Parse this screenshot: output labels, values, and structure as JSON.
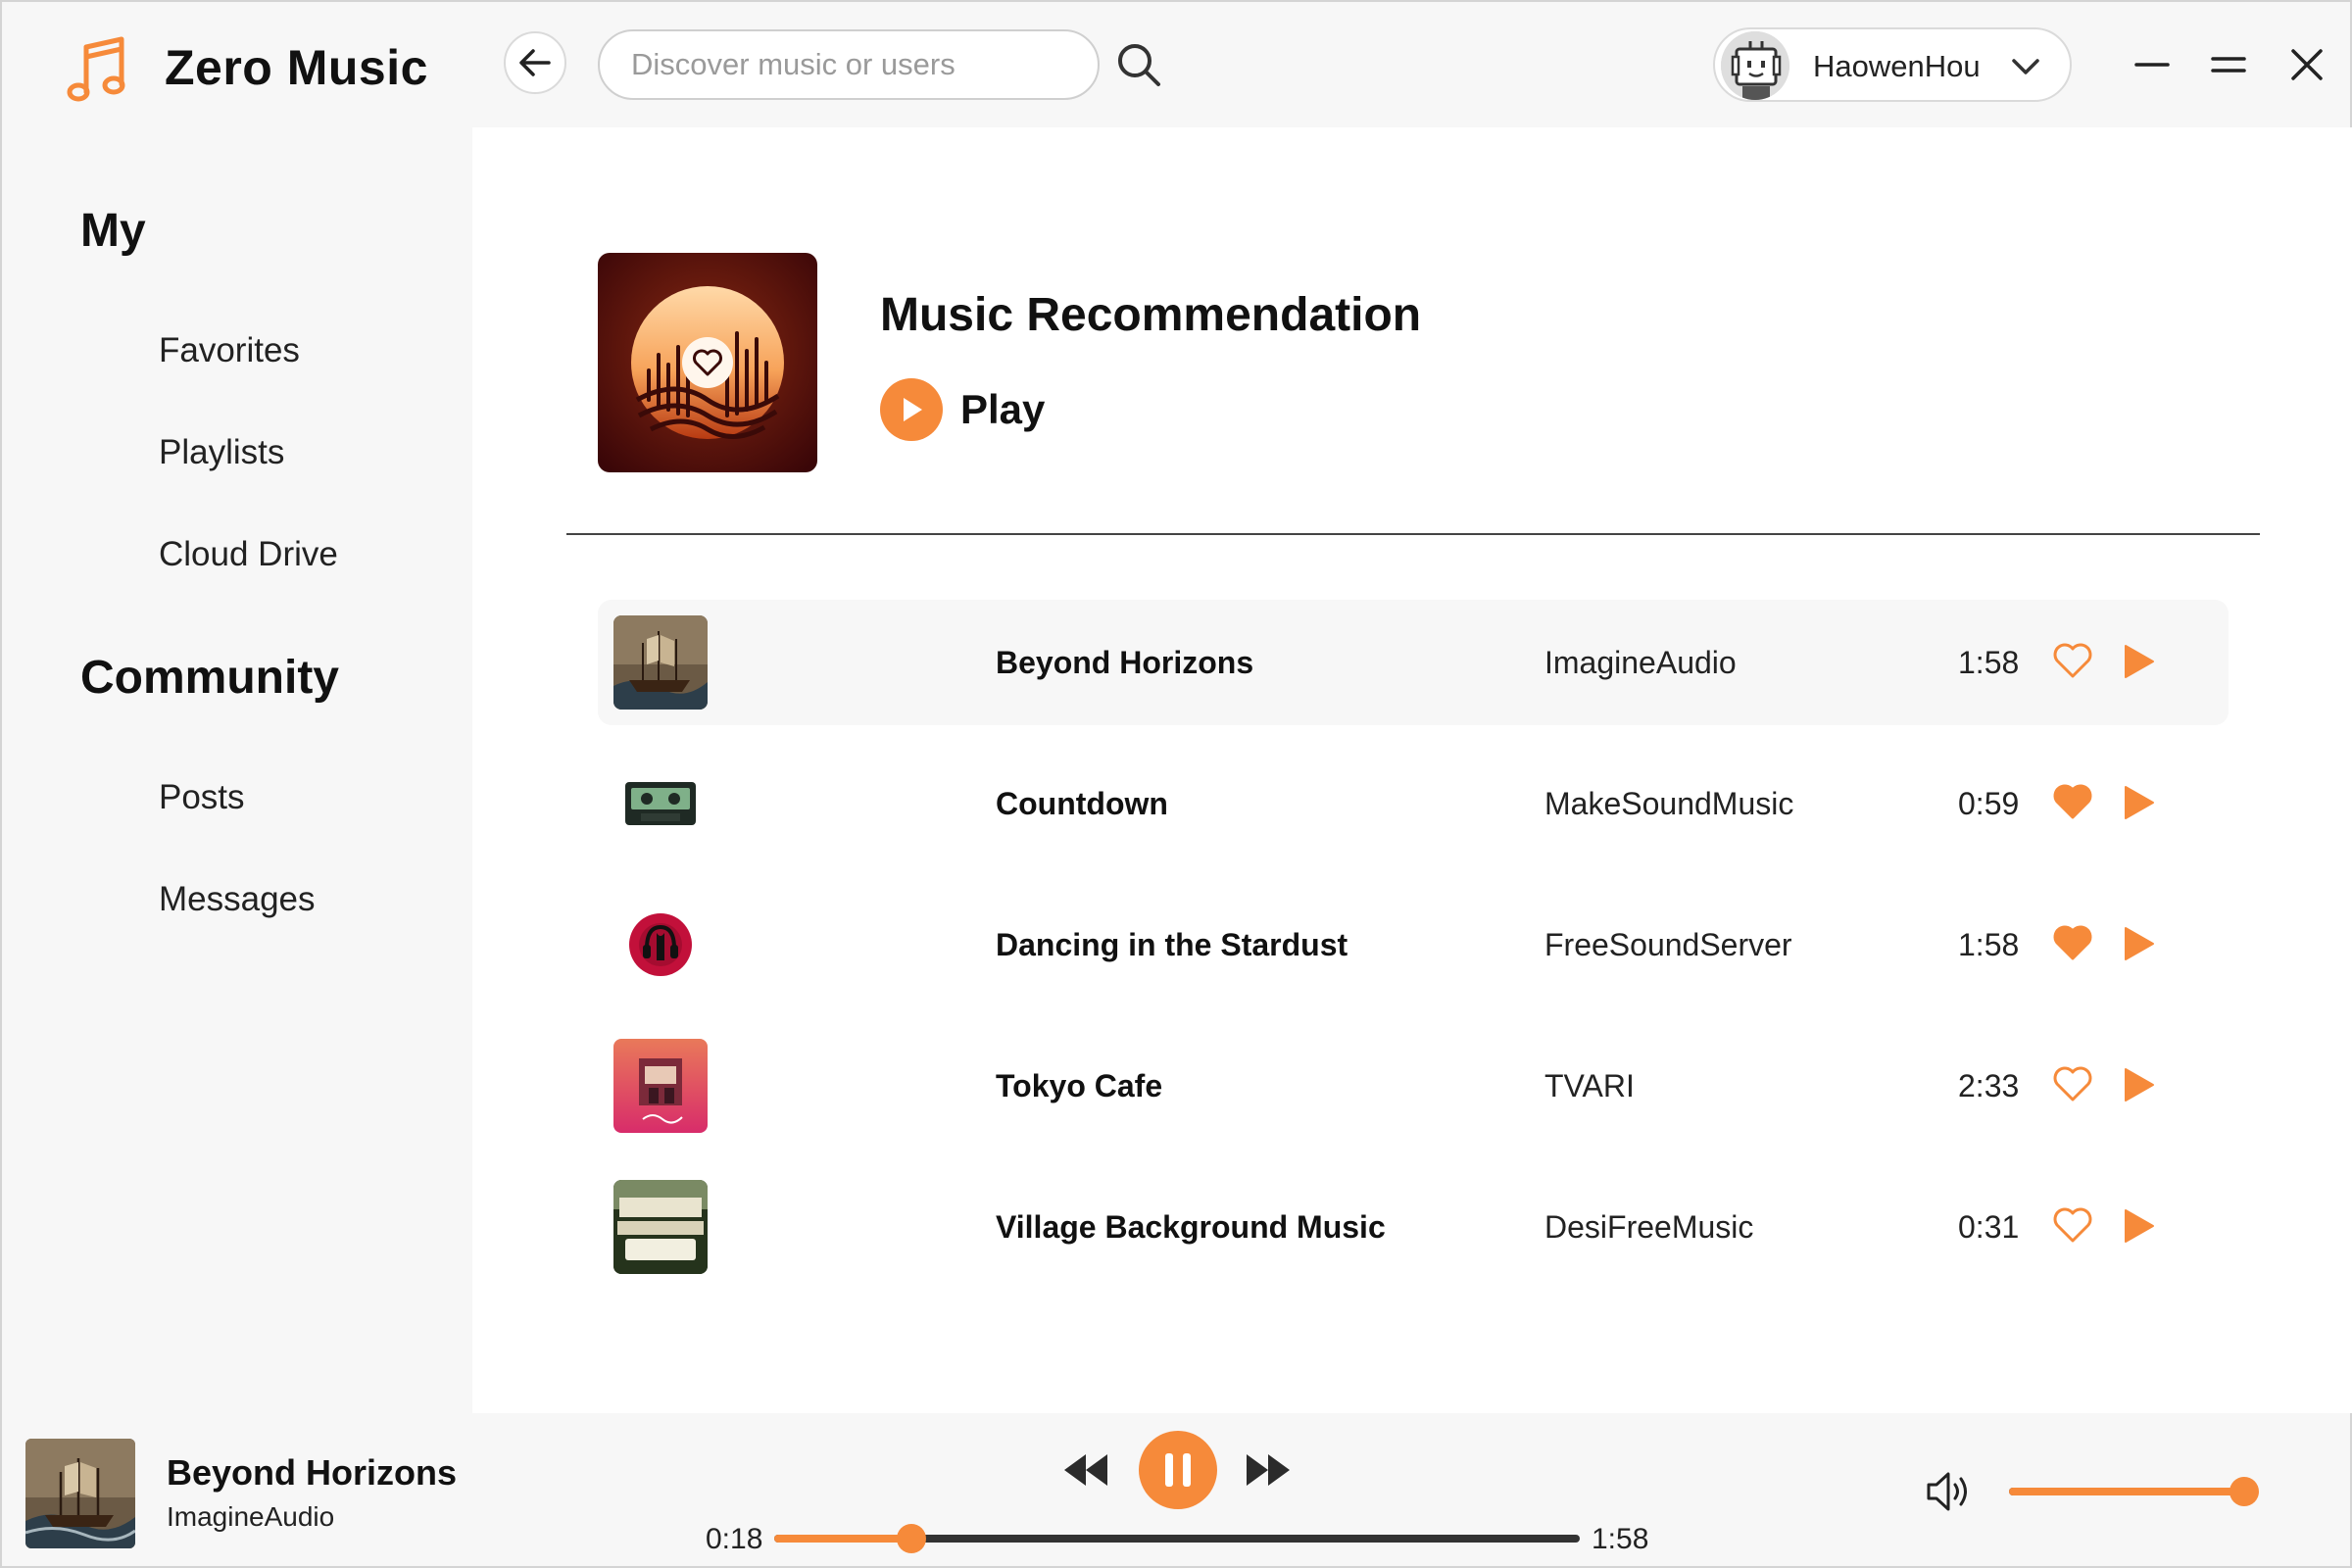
{
  "app": {
    "name": "Zero Music",
    "accent_color": "#f68a3a",
    "logo_icon": "music-note-icon"
  },
  "header": {
    "back_icon": "arrow-left-icon",
    "search": {
      "placeholder": "Discover music or users",
      "value": "",
      "icon": "search-icon"
    },
    "user": {
      "name": "HaowenHou",
      "avatar_icon": "robot-avatar-icon",
      "menu_icon": "chevron-down-icon"
    },
    "window_controls": [
      "minimize-icon",
      "maximize-icon",
      "close-icon"
    ]
  },
  "sidebar": {
    "sections": [
      {
        "title": "My",
        "items": [
          {
            "label": "Favorites"
          },
          {
            "label": "Playlists"
          },
          {
            "label": "Cloud Drive"
          }
        ]
      },
      {
        "title": "Community",
        "items": [
          {
            "label": "Posts"
          },
          {
            "label": "Messages"
          }
        ]
      }
    ]
  },
  "main": {
    "playlist": {
      "title": "Music Recommendation",
      "play_label": "Play",
      "cover_icon": "vinyl-heart-icon"
    },
    "tracks": [
      {
        "title": "Beyond Horizons",
        "artist": "ImagineAudio",
        "duration": "1:58",
        "liked": false,
        "thumb": "pirate-ship-art"
      },
      {
        "title": "Countdown",
        "artist": "MakeSoundMusic",
        "duration": "0:59",
        "liked": true,
        "thumb": "cassette-art"
      },
      {
        "title": "Dancing in the Stardust",
        "artist": "FreeSoundServer",
        "duration": "1:58",
        "liked": true,
        "thumb": "red-headphones-art"
      },
      {
        "title": "Tokyo Cafe",
        "artist": "TVARI",
        "duration": "2:33",
        "liked": false,
        "thumb": "tokyo-cafe-art"
      },
      {
        "title": "Village Background Music",
        "artist": "DesiFreeMusic",
        "duration": "0:31",
        "liked": false,
        "thumb": "village-music-art"
      }
    ]
  },
  "player": {
    "now_playing": {
      "title": "Beyond Horizons",
      "artist": "ImagineAudio"
    },
    "time_current": "0:18",
    "time_total": "1:58",
    "progress_fraction": 0.17,
    "volume_fraction": 1.0,
    "controls": [
      "rewind-icon",
      "pause-icon",
      "fast-forward-icon"
    ],
    "volume_icon": "speaker-icon"
  }
}
